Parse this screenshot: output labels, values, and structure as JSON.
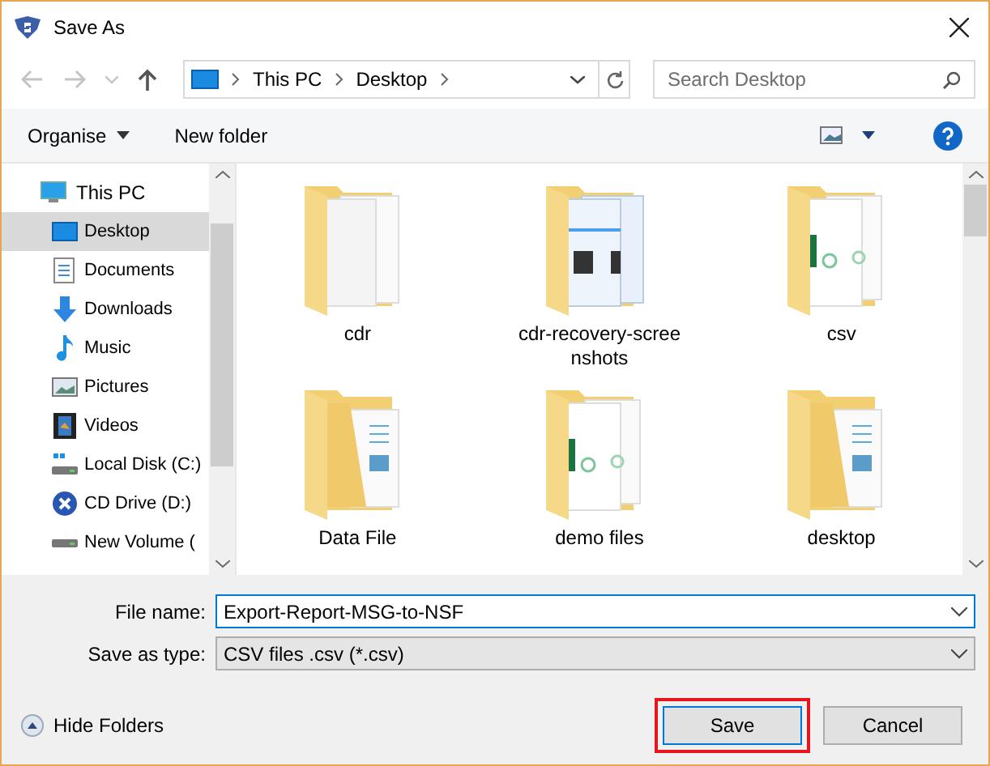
{
  "window": {
    "title": "Save As"
  },
  "nav": [
    {
      "kind": "back",
      "disabled": true
    },
    {
      "kind": "forward",
      "disabled": true
    },
    {
      "kind": "recent",
      "disabled": true
    },
    {
      "kind": "up",
      "disabled": false
    }
  ],
  "address": {
    "crumbs": [
      "This PC",
      "Desktop"
    ]
  },
  "search": {
    "placeholder": "Search Desktop"
  },
  "toolbar": {
    "organise": "Organise",
    "new_folder": "New folder"
  },
  "sidebar": {
    "items": [
      {
        "label": "This PC",
        "kind": "pc",
        "selected": false,
        "children": [
          {
            "label": "Desktop",
            "kind": "desktop",
            "selected": true
          },
          {
            "label": "Documents",
            "kind": "documents",
            "selected": false
          },
          {
            "label": "Downloads",
            "kind": "downloads",
            "selected": false
          },
          {
            "label": "Music",
            "kind": "music",
            "selected": false
          },
          {
            "label": "Pictures",
            "kind": "pictures",
            "selected": false
          },
          {
            "label": "Videos",
            "kind": "videos",
            "selected": false
          },
          {
            "label": "Local Disk (C:)",
            "kind": "disk",
            "selected": false
          },
          {
            "label": "CD Drive (D:)",
            "kind": "cd",
            "selected": false
          },
          {
            "label": "New Volume (",
            "kind": "volume",
            "selected": false
          }
        ]
      }
    ]
  },
  "folders": [
    {
      "name": "cdr",
      "kind": "blank"
    },
    {
      "name": "cdr-recovery-scree nshots",
      "kind": "screenshots"
    },
    {
      "name": "csv",
      "kind": "spreadsheet"
    },
    {
      "name": "Data File",
      "kind": "document"
    },
    {
      "name": "demo files",
      "kind": "spreadsheet"
    },
    {
      "name": "desktop",
      "kind": "document"
    }
  ],
  "form": {
    "file_name": {
      "label": "File name:",
      "value": "Export-Report-MSG-to-NSF"
    },
    "save_type": {
      "label": "Save as type:",
      "value": "CSV files .csv (*.csv)"
    }
  },
  "hide_folders": "Hide Folders",
  "buttons": [
    {
      "label": "Save",
      "highlighted": true
    },
    {
      "label": "Cancel",
      "highlighted": false
    }
  ]
}
